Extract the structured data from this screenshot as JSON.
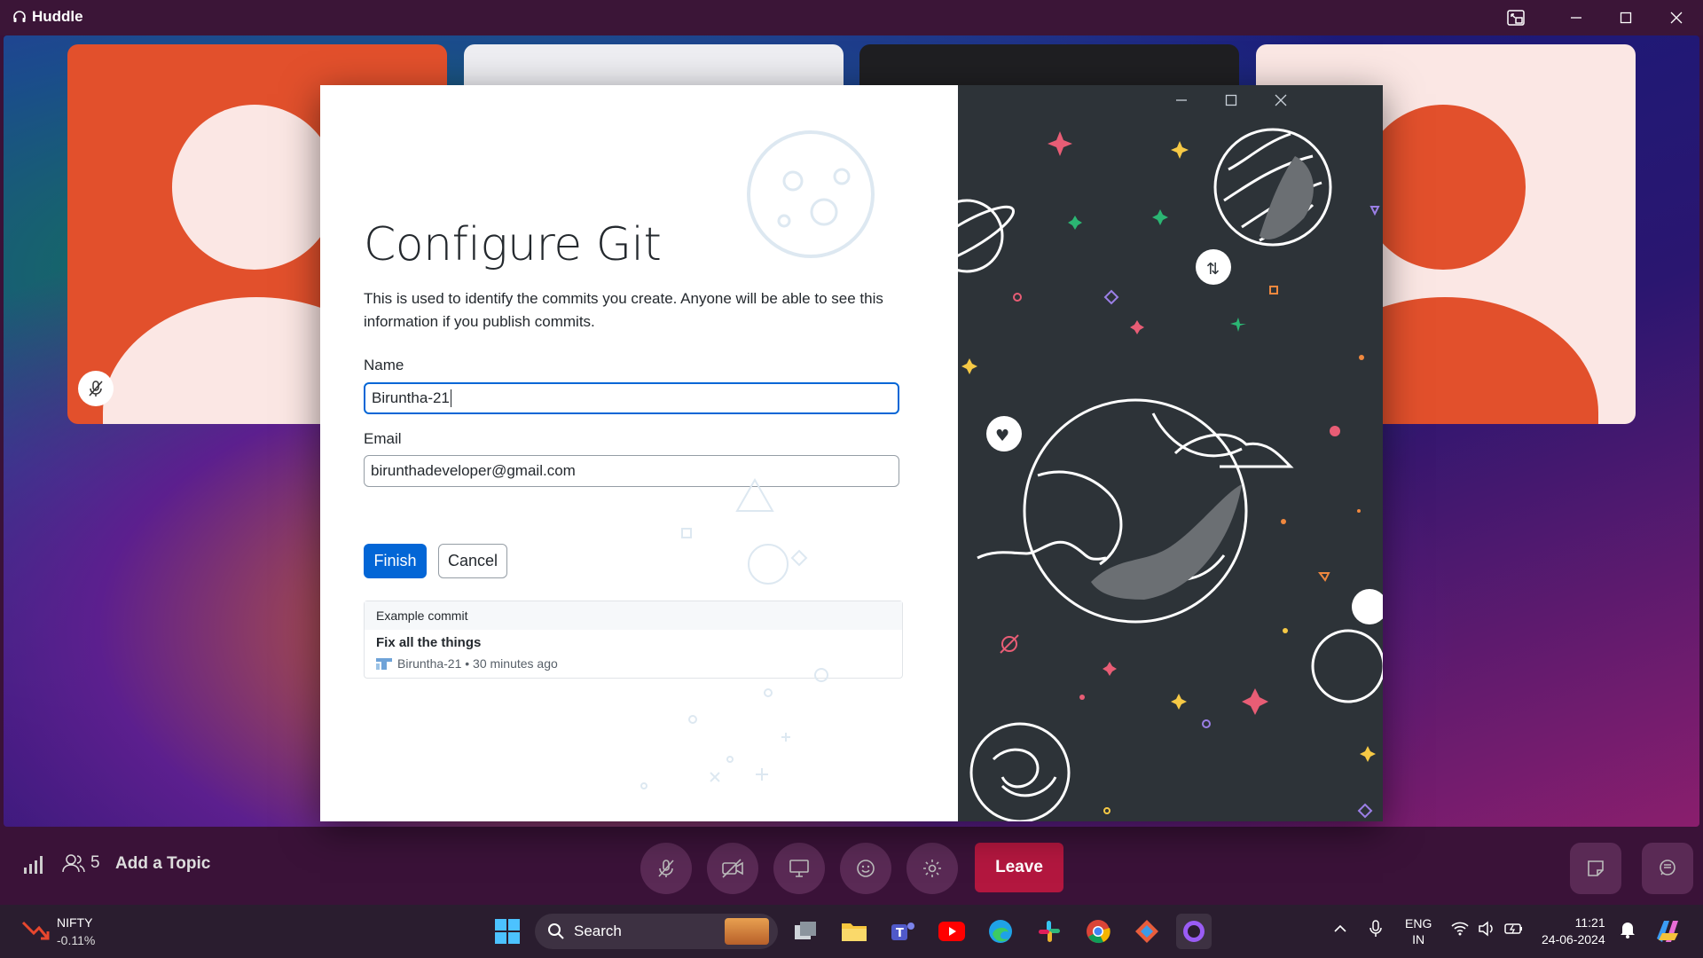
{
  "huddle": {
    "title": "Huddle",
    "participants_count": "5",
    "topic_placeholder": "Add a Topic",
    "leave_label": "Leave"
  },
  "dialog": {
    "title": "Configure Git",
    "description": "This is used to identify the commits you create. Anyone will be able to see this information if you publish commits.",
    "name_label": "Name",
    "name_value": "Biruntha-21",
    "email_label": "Email",
    "email_value": "birunthadeveloper@gmail.com",
    "finish_label": "Finish",
    "cancel_label": "Cancel",
    "example": {
      "header": "Example commit",
      "message": "Fix all the things",
      "meta": "Biruntha-21 • 30 minutes ago"
    }
  },
  "taskbar": {
    "stock_name": "NIFTY",
    "stock_change": "-0.11%",
    "search_label": "Search",
    "lang_top": "ENG",
    "lang_bottom": "IN",
    "time": "11:21",
    "date": "24-06-2024"
  },
  "colors": {
    "huddle_bg": "#3a1238",
    "avatar_orange": "#e2502c",
    "leave_red": "#b3173f",
    "git_blue": "#0366d6",
    "space_bg": "#2d3338"
  }
}
